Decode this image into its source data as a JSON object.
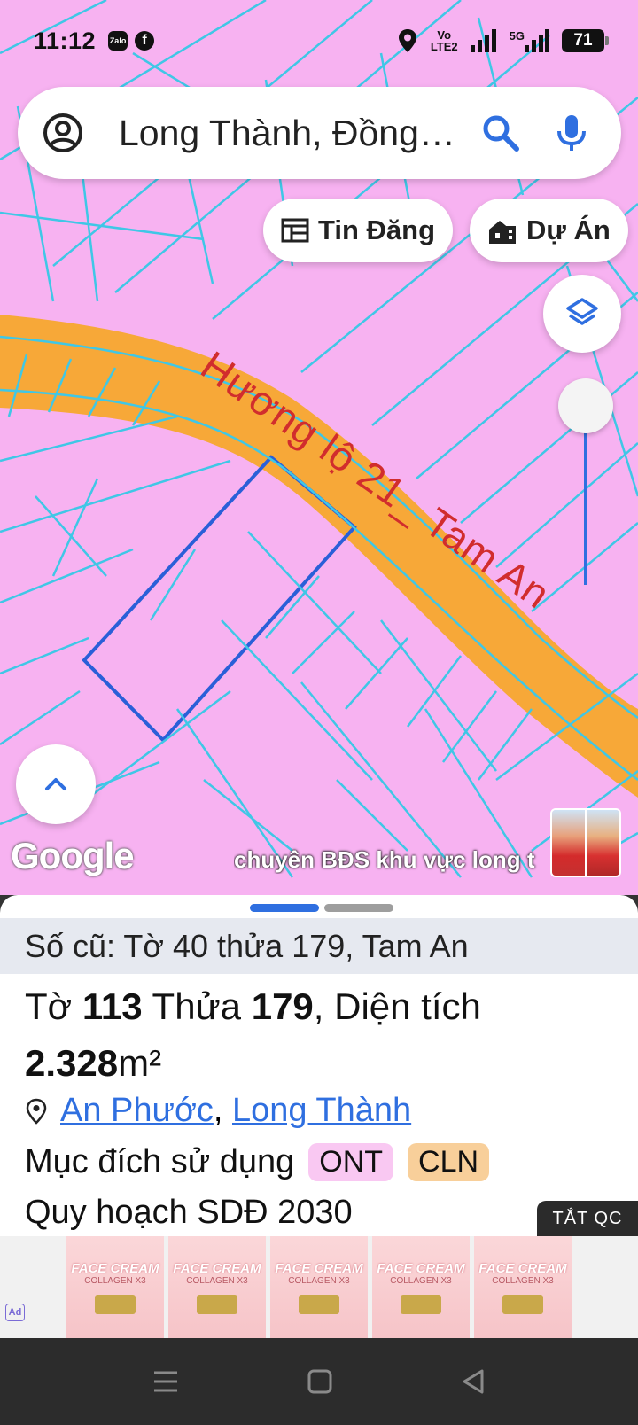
{
  "status_bar": {
    "time": "11:12",
    "notifications": [
      "Zalo",
      "f"
    ],
    "network": {
      "volte_top": "Vo",
      "volte_bottom": "LTE2",
      "fiveg": "5G"
    },
    "battery": "71"
  },
  "search": {
    "query": "Long Thành, Đồng…"
  },
  "chips": [
    {
      "label": "Tin Đăng",
      "icon": "listing-icon"
    },
    {
      "label": "Dự Án",
      "icon": "building-icon"
    }
  ],
  "map": {
    "road_label": "Hương lộ 21_ Tam An",
    "attribution": "Google",
    "caption": "chuyên BĐS khu vực long t"
  },
  "colors": {
    "land_pink": "#f7b2f1",
    "road_orange": "#f7a838",
    "parcel_lines": "#3fc7e6",
    "selected_parcel": "#2a5fd8",
    "accent_blue": "#2f6fe0"
  },
  "sheet": {
    "old_info": "Số cũ: Tờ 40 thửa 179, Tam An",
    "title": {
      "to_label": "Tờ ",
      "to_value": "113",
      "thua_label": " Thửa ",
      "thua_value": "179",
      "area_label": ", Diện tích ",
      "area_value": "2.328",
      "area_unit": "m²"
    },
    "location": {
      "ward": "An Phước",
      "separator": ", ",
      "district": "Long Thành"
    },
    "purpose_label": "Mục đích sử dụng",
    "tags": [
      "ONT",
      "CLN"
    ],
    "plan_label": "Quy hoạch SDĐ 2030"
  },
  "ad": {
    "close_label": "TẮT QC",
    "badge": "Ad",
    "tiles": [
      {
        "brand": "FACE CREAM",
        "sub": "COLLAGEN X3"
      },
      {
        "brand": "FACE CREAM",
        "sub": "COLLAGEN X3"
      },
      {
        "brand": "FACE CREAM",
        "sub": "COLLAGEN X3"
      },
      {
        "brand": "FACE CREAM",
        "sub": "COLLAGEN X3"
      },
      {
        "brand": "FACE CREAM",
        "sub": "COLLAGEN X3"
      }
    ]
  }
}
